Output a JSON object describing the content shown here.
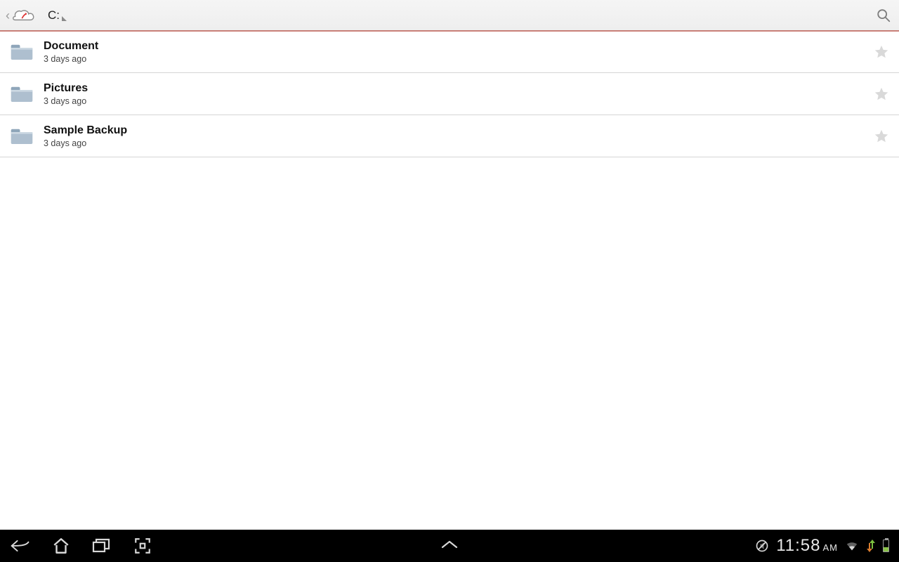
{
  "header": {
    "breadcrumb": "C:"
  },
  "folders": [
    {
      "name": "Document",
      "time": "3 days ago"
    },
    {
      "name": "Pictures",
      "time": "3 days ago"
    },
    {
      "name": "Sample Backup",
      "time": "3 days ago"
    }
  ],
  "status": {
    "time": "11:58",
    "ampm": "AM"
  }
}
